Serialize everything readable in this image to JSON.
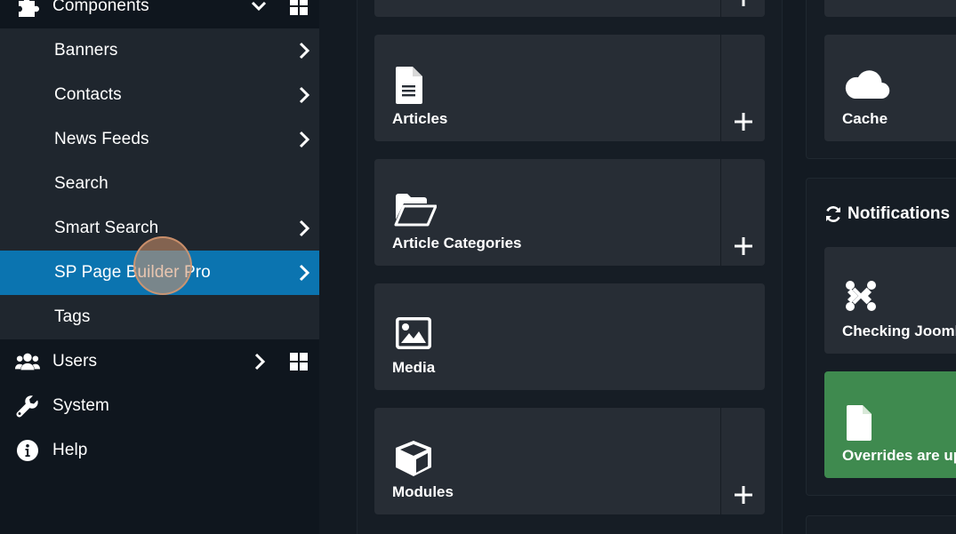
{
  "sidebar": {
    "components": {
      "label": "Components",
      "icon": "puzzle-icon"
    },
    "sub_items": [
      {
        "label": "Banners",
        "has_arrow": true
      },
      {
        "label": "Contacts",
        "has_arrow": true
      },
      {
        "label": "News Feeds",
        "has_arrow": true
      },
      {
        "label": "Search",
        "has_arrow": false
      },
      {
        "label": "Smart Search",
        "has_arrow": true
      },
      {
        "label": "SP Page Builder Pro",
        "has_arrow": true,
        "active": true
      },
      {
        "label": "Tags",
        "has_arrow": false
      }
    ],
    "users": {
      "label": "Users",
      "icon": "users-icon"
    },
    "system": {
      "label": "System",
      "icon": "wrench-icon"
    },
    "help": {
      "label": "Help",
      "icon": "info-icon"
    }
  },
  "cards": [
    {
      "label": "Articles",
      "icon": "file-text-icon",
      "has_add": true
    },
    {
      "label": "Article Categories",
      "icon": "folder-open-icon",
      "has_add": true
    },
    {
      "label": "Media",
      "icon": "image-icon",
      "has_add": false
    },
    {
      "label": "Modules",
      "icon": "cube-icon",
      "has_add": true
    }
  ],
  "right": {
    "cache_label": "Cache",
    "notifications_title": "Notifications",
    "notification_cards": [
      {
        "label": "Checking Joomla",
        "icon": "joomla-icon",
        "color": "#272d35"
      },
      {
        "label": "Overrides are up to date",
        "icon": "file-icon",
        "color": "#3f8a4f"
      }
    ]
  },
  "colors": {
    "active": "#0b74b0",
    "sidebar_bg": "#0f161e",
    "submenu_bg": "#1f262e",
    "card_bg": "#272d35",
    "success": "#3f8a4f"
  }
}
